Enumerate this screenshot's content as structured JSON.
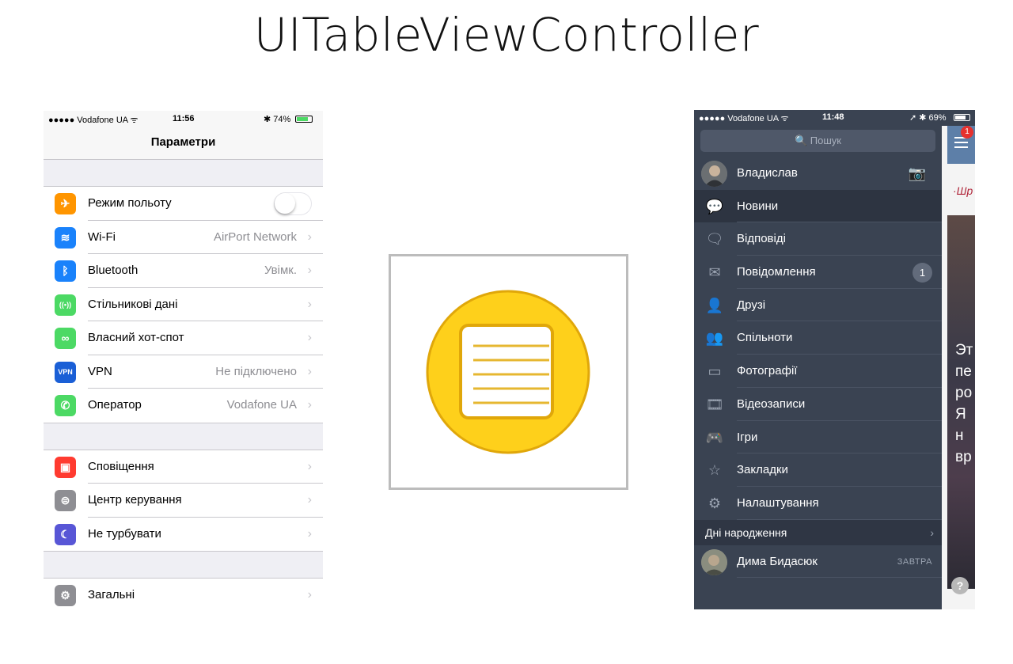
{
  "title": "UITableViewController",
  "ios": {
    "status": {
      "carrier": "●●●●● Vodafone UA ᯤ",
      "time": "11:56",
      "battery": "✱ 74%"
    },
    "nav_title": "Параметри",
    "group1": [
      {
        "label": "Режим польоту",
        "value": "",
        "icon": "airplane-icon",
        "color": "#ff9500",
        "glyph": "✈",
        "toggle": true
      },
      {
        "label": "Wi-Fi",
        "value": "AirPort Network",
        "icon": "wifi-icon",
        "color": "#1a82fb",
        "glyph": "≋"
      },
      {
        "label": "Bluetooth",
        "value": "Увімк.",
        "icon": "bluetooth-icon",
        "color": "#1a82fb",
        "glyph": "ᛒ"
      },
      {
        "label": "Стільникові дані",
        "value": "",
        "icon": "cellular-icon",
        "color": "#4cd964",
        "glyph": "((•))"
      },
      {
        "label": "Власний хот-спот",
        "value": "",
        "icon": "hotspot-icon",
        "color": "#4cd964",
        "glyph": "∞"
      },
      {
        "label": "VPN",
        "value": "Не підключено",
        "icon": "vpn-icon",
        "color": "#1a5fd6",
        "glyph": "VPN"
      },
      {
        "label": "Оператор",
        "value": "Vodafone UA",
        "icon": "phone-icon",
        "color": "#4cd964",
        "glyph": "✆"
      }
    ],
    "group2": [
      {
        "label": "Сповіщення",
        "value": "",
        "icon": "notifications-icon",
        "color": "#ff3b30",
        "glyph": "▣"
      },
      {
        "label": "Центр керування",
        "value": "",
        "icon": "control-center-icon",
        "color": "#8e8e93",
        "glyph": "⊜"
      },
      {
        "label": "Не турбувати",
        "value": "",
        "icon": "moon-icon",
        "color": "#5856d6",
        "glyph": "☾"
      }
    ],
    "group3": [
      {
        "label": "Загальні",
        "value": "",
        "icon": "gear-icon",
        "color": "#8e8e93",
        "glyph": "⚙"
      }
    ],
    "chevron": "›"
  },
  "vk": {
    "status": {
      "carrier": "●●●●● Vodafone UA ᯤ",
      "time": "11:48",
      "battery": "➚ ✱ 69%"
    },
    "search_placeholder": "🔍 Пошук",
    "profile": {
      "name": "Владислав",
      "camera": "📷"
    },
    "menu": [
      {
        "label": "Новини",
        "glyph": "💬",
        "icon": "news-icon",
        "active": true
      },
      {
        "label": "Відповіді",
        "glyph": "🗨",
        "icon": "replies-icon"
      },
      {
        "label": "Повідомлення",
        "glyph": "✉",
        "icon": "messages-icon",
        "badge": "1"
      },
      {
        "label": "Друзі",
        "glyph": "👤",
        "icon": "friends-icon"
      },
      {
        "label": "Спільноти",
        "glyph": "👥",
        "icon": "communities-icon"
      },
      {
        "label": "Фотографії",
        "glyph": "▭",
        "icon": "photos-icon"
      },
      {
        "label": "Відеозаписи",
        "glyph": "🎞",
        "icon": "videos-icon"
      },
      {
        "label": "Ігри",
        "glyph": "🎮",
        "icon": "games-icon"
      },
      {
        "label": "Закладки",
        "glyph": "☆",
        "icon": "bookmarks-icon"
      },
      {
        "label": "Налаштування",
        "glyph": "⚙",
        "icon": "settings-icon"
      }
    ],
    "birthdays": {
      "section": "Дні народження",
      "chevron": "›",
      "name": "Дима Бидасюк",
      "when": "ЗАВТРА"
    },
    "peek": {
      "text": "Эт\nпе\nро\nЯ н\nвр",
      "logo": "·Шр",
      "notif": "1",
      "help": "?"
    }
  }
}
